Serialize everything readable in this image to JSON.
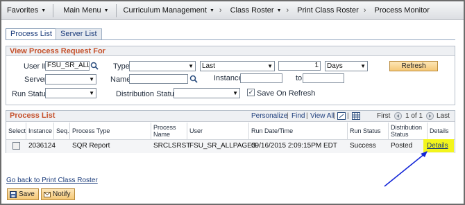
{
  "nav": {
    "items": [
      "Favorites",
      "Main Menu",
      "Curriculum Management",
      "Class Roster",
      "Print Class Roster",
      "Process Monitor"
    ]
  },
  "tabs": {
    "active": "Process List",
    "inactive": "Server List"
  },
  "request": {
    "title": "View Process Request For",
    "userid_label": "User ID",
    "userid_value": "FSU_SR_ALLP",
    "type_label": "Type",
    "type_value": "",
    "last_value": "Last",
    "last_count": "1",
    "unit_value": "Days",
    "refresh_label": "Refresh",
    "server_label": "Server",
    "server_value": "",
    "name_label": "Name",
    "name_value": "",
    "instance_label": "Instance",
    "instance_from": "",
    "to_label": "to",
    "instance_to": "",
    "run_status_label": "Run Status",
    "run_status_value": "",
    "dist_status_label": "Distribution Status",
    "dist_status_value": "",
    "save_on_refresh_label": "Save On Refresh",
    "save_on_refresh_checked": true
  },
  "process_list": {
    "title": "Process List",
    "personalize": "Personalize",
    "find": "Find",
    "view_all": "View All",
    "first": "First",
    "range": "1 of 1",
    "last": "Last",
    "columns": [
      "Select",
      "Instance",
      "Seq.",
      "Process Type",
      "Process Name",
      "User",
      "Run Date/Time",
      "Run Status",
      "Distribution Status",
      "Details"
    ],
    "rows": [
      {
        "instance": "2036124",
        "seq": "",
        "process_type": "SQR Report",
        "process_name": "SRCLSRST",
        "user": "FSU_SR_ALLPAGES",
        "run_datetime": "09/16/2015  2:09:15PM EDT",
        "run_status": "Success",
        "distribution_status": "Posted",
        "details": "Details"
      }
    ]
  },
  "footer": {
    "go_back": "Go back to Print Class Roster",
    "save": "Save",
    "notify": "Notify"
  },
  "colors": {
    "accent": "#c5502a",
    "link": "#1a3b7a",
    "highlight": "#f3f51c",
    "arrow": "#1326d8"
  }
}
